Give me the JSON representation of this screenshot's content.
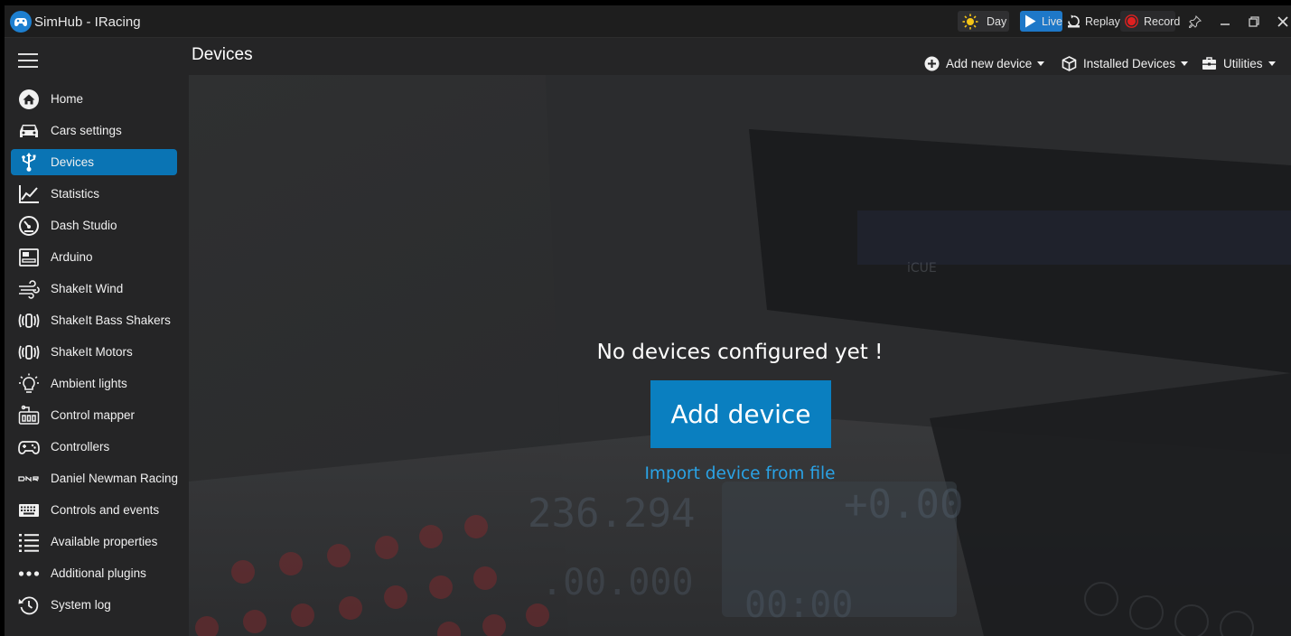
{
  "window": {
    "title": "SimHub - IRacing"
  },
  "titlebar": {
    "day_label": "Day",
    "live_label": "Live",
    "replay_label": "Replay",
    "record_label": "Record"
  },
  "sidebar": {
    "items": [
      {
        "label": "Home",
        "icon": "home-icon"
      },
      {
        "label": "Cars settings",
        "icon": "car-icon"
      },
      {
        "label": "Devices",
        "icon": "usb-icon",
        "active": true
      },
      {
        "label": "Statistics",
        "icon": "chart-line-icon"
      },
      {
        "label": "Dash Studio",
        "icon": "gauge-icon"
      },
      {
        "label": "Arduino",
        "icon": "arduino-icon"
      },
      {
        "label": "ShakeIt Wind",
        "icon": "wind-icon"
      },
      {
        "label": "ShakeIt Bass Shakers",
        "icon": "vibration-icon"
      },
      {
        "label": "ShakeIt Motors",
        "icon": "vibration-icon"
      },
      {
        "label": "Ambient lights",
        "icon": "lightbulb-icon"
      },
      {
        "label": "Control mapper",
        "icon": "control-mapper-icon"
      },
      {
        "label": "Controllers",
        "icon": "gamepad-icon"
      },
      {
        "label": "Daniel Newman Racing",
        "icon": "dnr-logo-icon"
      },
      {
        "label": "Controls and events",
        "icon": "keyboard-icon"
      },
      {
        "label": "Available properties",
        "icon": "list-icon"
      },
      {
        "label": "Additional plugins",
        "icon": "more-dots-icon"
      },
      {
        "label": "System log",
        "icon": "history-icon"
      }
    ]
  },
  "header": {
    "title": "Devices",
    "add_new_device": "Add new device",
    "installed_devices": "Installed Devices",
    "utilities": "Utilities"
  },
  "main": {
    "empty_message": "No devices configured yet !",
    "add_device_label": "Add device",
    "import_label": "Import device from file"
  },
  "colors": {
    "accent": "#0a74b4",
    "button": "#0a7fc0",
    "link": "#2aa3e6",
    "record_red": "#e02020"
  }
}
